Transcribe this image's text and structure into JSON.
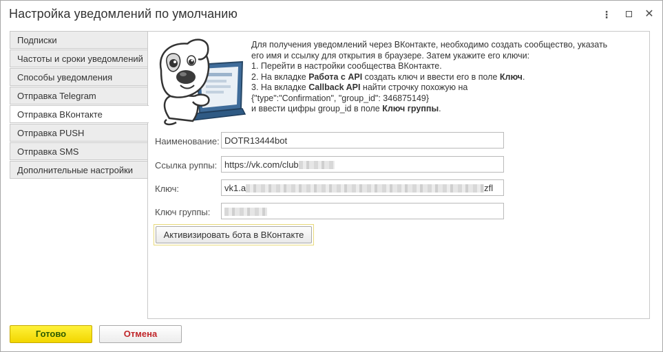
{
  "window": {
    "title": "Настройка уведомлений по умолчанию",
    "more_glyph": "⋮",
    "close_glyph": "✕"
  },
  "nav": {
    "items": [
      {
        "label": "Подписки",
        "active": false
      },
      {
        "label": "Частоты и сроки уведомлений",
        "active": false
      },
      {
        "label": "Способы уведомления",
        "active": false
      },
      {
        "label": "Отправка Telegram",
        "active": false
      },
      {
        "label": "Отправка ВКонтакте",
        "active": true
      },
      {
        "label": "Отправка PUSH",
        "active": false
      },
      {
        "label": "Отправка SMS",
        "active": false
      },
      {
        "label": "Дополнительные настройки",
        "active": false
      }
    ]
  },
  "info": {
    "line1": "Для получения уведомлений через ВКонтакте, необходимо создать сообщество, указать",
    "line2": "его имя и ссылку для открытия в браузере. Затем укажите его ключи:",
    "line3": "1. Перейти в настройки сообщества ВКонтакте.",
    "line4_pre": "2. На вкладке ",
    "line4_bold1": "Работа с API",
    "line4_mid": " создать ключ и ввести его в поле ",
    "line4_bold2": "Ключ",
    "line4_post": ".",
    "line5_pre": "3. На вкладке ",
    "line5_bold": "Callback API",
    "line5_post": " найти строчку похожую на",
    "line6": "{\"type\":\"Confirmation\", \"group_id\": 346875149}",
    "line7_pre": "и ввести цифры group_id в поле ",
    "line7_bold": "Ключ группы",
    "line7_post": "."
  },
  "form": {
    "name_label": "Наименование:",
    "name_value": "DOTR13444bot",
    "link_label": "Ссылка руппы:",
    "link_value": "https://vk.com/club",
    "key_label": "Ключ:",
    "key_value_start": "vk1.a",
    "key_value_end": "zfl",
    "group_key_label": "Ключ группы:"
  },
  "actions": {
    "activate_label": "Активизировать бота в ВКонтакте",
    "ok_label": "Готово",
    "cancel_label": "Отмена"
  },
  "icons": {
    "more": "more-vertical-icon",
    "restore": "maximize-icon",
    "close": "close-icon",
    "mascot": "vk-dog-mascot-icon"
  },
  "colors": {
    "ok_button": "#f5dc00",
    "ok_text": "#2d5b00",
    "cancel_text": "#c0262a",
    "highlight_border": "#e8d97a"
  }
}
